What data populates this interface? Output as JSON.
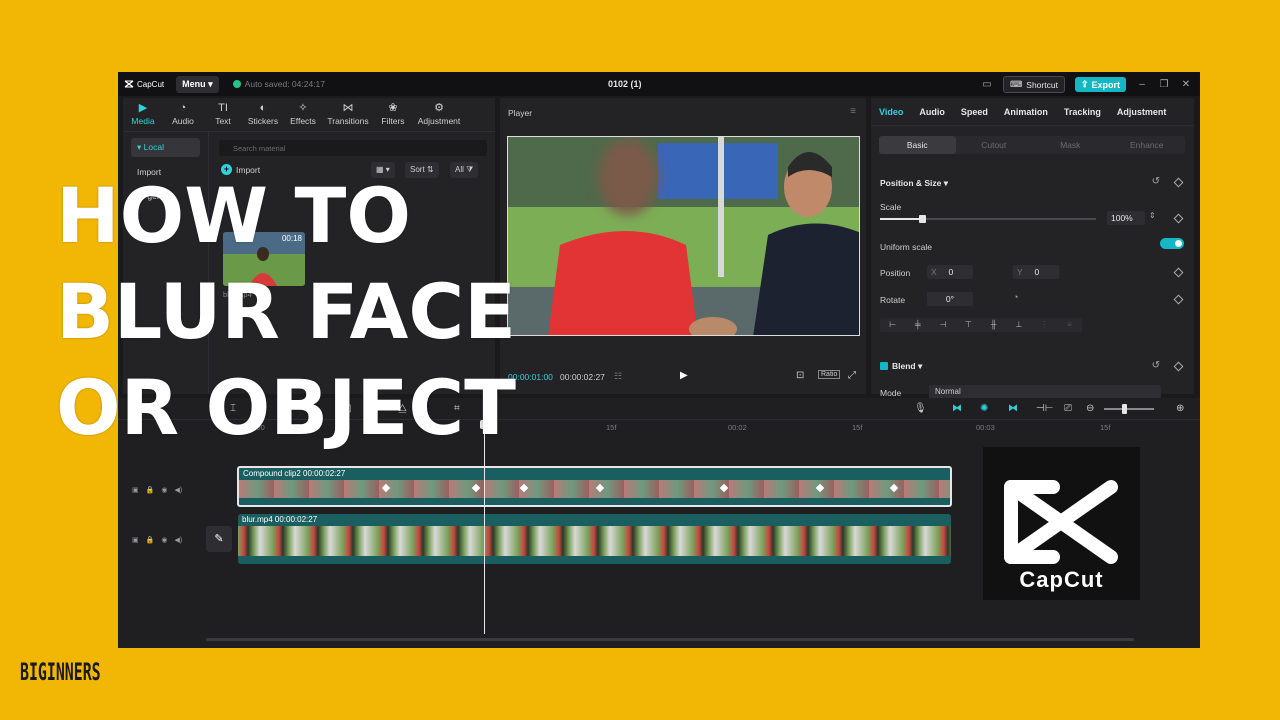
{
  "overlay": {
    "title_lines": [
      "HOW TO",
      "BLUR FACE",
      "OR OBJECT"
    ],
    "footer_tag": "BIGINNERS",
    "brand_card_text": "CapCut",
    "background_color": "#F2B705"
  },
  "topbar": {
    "app_name": "CapCut",
    "menu_label": "Menu",
    "autosave": "Auto saved: 04:24:17",
    "project_title": "0102 (1)",
    "shortcut_label": "Shortcut",
    "export_label": "Export"
  },
  "media": {
    "tools": [
      {
        "label": "Media",
        "icon": "media-icon"
      },
      {
        "label": "Audio",
        "icon": "audio-icon"
      },
      {
        "label": "Text",
        "icon": "text-icon"
      },
      {
        "label": "Stickers",
        "icon": "stickers-icon"
      },
      {
        "label": "Effects",
        "icon": "effects-icon"
      },
      {
        "label": "Transitions",
        "icon": "transitions-icon"
      },
      {
        "label": "Filters",
        "icon": "filters-icon"
      },
      {
        "label": "Adjustment",
        "icon": "adjustment-icon"
      }
    ],
    "side_local": "Local",
    "side_import": "Import",
    "side_ai": "AI gen",
    "search_placeholder": "Search material",
    "import_label": "Import",
    "sort_label": "Sort",
    "all_label": "All",
    "thumb_tag": "Ad",
    "thumb_duration": "00:18",
    "thumb_name": "blur.mp4"
  },
  "player": {
    "title": "Player",
    "current_time": "00:00:01:00",
    "total_time": "00:00:02:27",
    "ratio_label": "Ratio"
  },
  "props": {
    "tabs": [
      "Video",
      "Audio",
      "Speed",
      "Animation",
      "Tracking",
      "Adjustment"
    ],
    "subtabs": [
      "Basic",
      "Cutout",
      "Mask",
      "Enhance"
    ],
    "position_size": "Position & Size",
    "scale_label": "Scale",
    "scale_value": "100%",
    "uniform_scale": "Uniform scale",
    "position_label": "Position",
    "x_label": "X",
    "x_value": "0",
    "y_label": "Y",
    "y_value": "0",
    "rotate_label": "Rotate",
    "rotate_value": "0°",
    "blend_label": "Blend",
    "mode_label": "Mode",
    "mode_value": "Normal",
    "scale_fraction": 0.2
  },
  "timeline": {
    "ruler": [
      "00:00",
      "15f",
      "00:02",
      "15f",
      "00:03",
      "15f"
    ],
    "compound_label": "Compound clip2  00:00:02:27",
    "main_label": "blur.mp4  00:00:02:27"
  }
}
